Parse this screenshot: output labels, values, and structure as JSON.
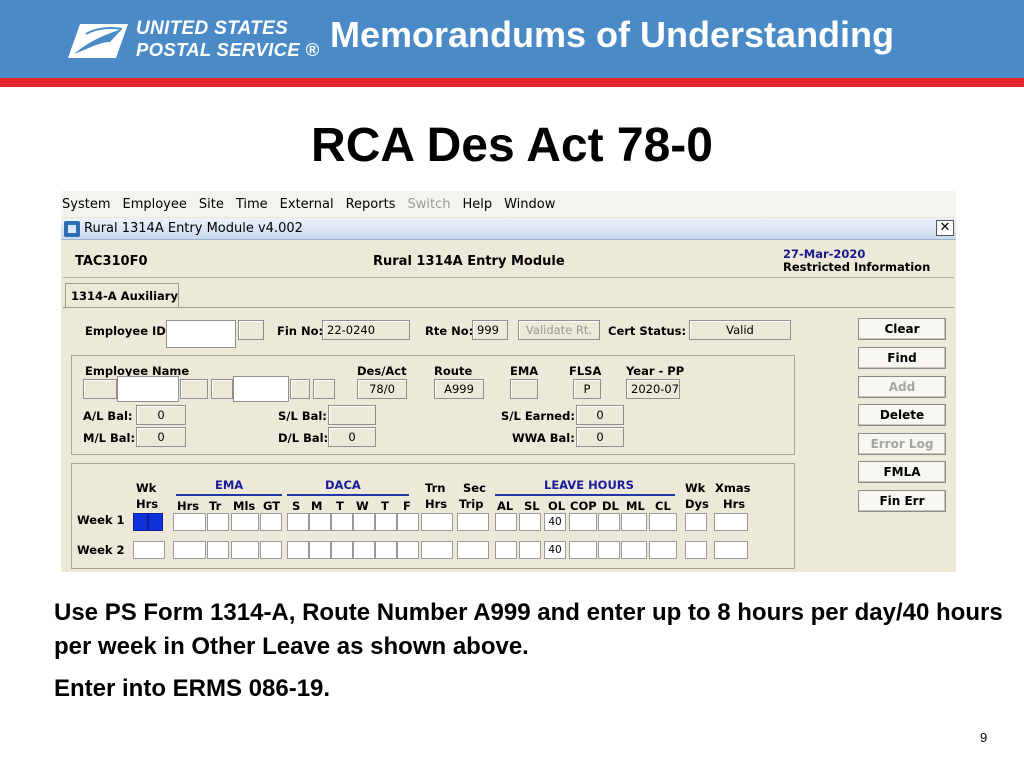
{
  "slide": {
    "deck_title": "Memorandums of Understanding",
    "title": "RCA Des Act 78-0",
    "logo_line1": "UNITED STATES",
    "logo_line2": "POSTAL SERVICE ®",
    "note_line1": "Use PS Form 1314-A, Route Number A999 and enter up to 8 hours per day/40 hours per week in Other Leave as shown above.",
    "note_line2": "Enter into ERMS 086-19.",
    "page_number": "9",
    "colors": {
      "banner": "#4a8bc7",
      "accent_line": "#e3262b"
    }
  },
  "app": {
    "menu": [
      "System",
      "Employee",
      "Site",
      "Time",
      "External",
      "Reports",
      "Switch",
      "Help",
      "Window"
    ],
    "menu_disabled": [
      "Switch"
    ],
    "window_title": "Rural 1314A Entry Module v4.002",
    "close_glyph": "✕",
    "module_code": "TAC310F0",
    "module_name": "Rural 1314A Entry Module",
    "date": "27-Mar-2020",
    "info": "Restricted Information",
    "tab": "1314-A Auxiliary",
    "form": {
      "employee_id_label": "Employee ID",
      "fin_no_label": "Fin No:",
      "fin_no": "22-0240",
      "rte_no_label": "Rte No:",
      "rte_no": "999",
      "validate_label": "Validate Rt.",
      "cert_status_label": "Cert Status:",
      "cert_status": "Valid",
      "employee_name_label": "Employee Name",
      "des_act_label": "Des/Act",
      "des_act": "78/0",
      "route_label": "Route",
      "route": "A999",
      "ema_label": "EMA",
      "flsa_label": "FLSA",
      "flsa": "P",
      "year_pp_label": "Year - PP",
      "year_pp": "2020-07",
      "al_bal_label": "A/L Bal:",
      "al_bal": "0",
      "ml_bal_label": "M/L Bal:",
      "ml_bal": "0",
      "sl_bal_label": "S/L Bal:",
      "dl_bal_label": "D/L Bal:",
      "dl_bal": "0",
      "sl_earned_label": "S/L Earned:",
      "sl_earned": "0",
      "wwa_bal_label": "WWA Bal:",
      "wwa_bal": "0"
    },
    "buttons": [
      "Clear",
      "Find",
      "Add",
      "Delete",
      "Error Log",
      "FMLA",
      "Fin Err"
    ],
    "buttons_disabled": [
      "Add",
      "Error Log"
    ],
    "grid": {
      "wk_label": "Wk",
      "hrs_label": "Hrs",
      "ema_group": "EMA",
      "daca_group": "DACA",
      "trn_label": "Trn",
      "sec_label": "Sec",
      "trip_label": "Trip",
      "leave_group": "LEAVE HOURS",
      "wk_dys_1": "Wk",
      "wk_dys_2": "Dys",
      "xmas_1": "Xmas",
      "xmas_2": "Hrs",
      "ema_cols": [
        "Hrs",
        "Tr",
        "Mls",
        "GT"
      ],
      "daca_cols": [
        "S",
        "M",
        "T",
        "W",
        "T",
        "F"
      ],
      "leave_cols": [
        "AL",
        "SL",
        "OL",
        "COP",
        "DL",
        "ML",
        "CL"
      ],
      "week1_label": "Week 1",
      "week2_label": "Week 2",
      "week1_ol": "40",
      "week2_ol": "40"
    }
  }
}
